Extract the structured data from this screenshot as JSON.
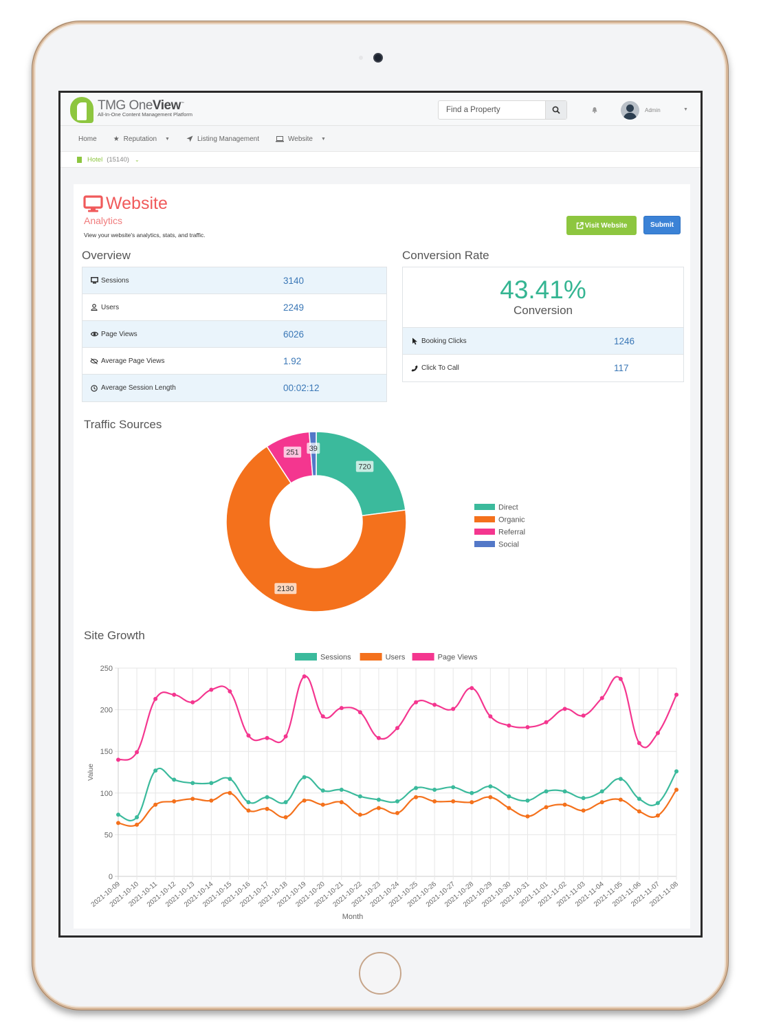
{
  "header": {
    "logo_main": "TMG One",
    "logo_bold": "View",
    "logo_tm": "™",
    "logo_sub": "All-In-One Content Management Platform",
    "search_placeholder": "Find a Property",
    "user_name": "Admin"
  },
  "nav": {
    "items": [
      {
        "label": "Home",
        "icon": "none",
        "has_caret": false
      },
      {
        "label": "Reputation",
        "icon": "star-icon",
        "has_caret": true
      },
      {
        "label": "Listing Management",
        "icon": "location-arrow-icon",
        "has_caret": false
      },
      {
        "label": "Website",
        "icon": "laptop-icon",
        "has_caret": true
      }
    ]
  },
  "property": {
    "type": "Hotel",
    "id": "(15140)"
  },
  "page": {
    "title": "Website",
    "subtitle": "Analytics",
    "description": "View your website's analytics, stats, and traffic.",
    "visit_button": "Visit Website",
    "submit_button": "Submit"
  },
  "overview": {
    "heading": "Overview",
    "rows": [
      {
        "label": "Sessions",
        "value": "3140",
        "icon": "desktop-icon"
      },
      {
        "label": "Users",
        "value": "2249",
        "icon": "user-icon"
      },
      {
        "label": "Page Views",
        "value": "6026",
        "icon": "eye-icon"
      },
      {
        "label": "Average Page Views",
        "value": "1.92",
        "icon": "eye-slash-icon"
      },
      {
        "label": "Average Session Length",
        "value": "00:02:12",
        "icon": "clock-icon"
      }
    ]
  },
  "conversion": {
    "heading": "Conversion Rate",
    "rate": "43.41%",
    "label": "Conversion",
    "rows": [
      {
        "label": "Booking Clicks",
        "value": "1246",
        "icon": "cursor-icon"
      },
      {
        "label": "Click To Call",
        "value": "117",
        "icon": "phone-icon"
      }
    ]
  },
  "colors": {
    "direct": "#3bba9c",
    "organic": "#f4711c",
    "referral": "#f4368f",
    "social": "#5378c8",
    "accent_red": "#f05a5b",
    "brand_green": "#8dc63f",
    "link_blue": "#3a77b6"
  },
  "chart_data": [
    {
      "type": "pie",
      "title": "Traffic Sources",
      "donut": true,
      "categories": [
        "Direct",
        "Organic",
        "Referral",
        "Social"
      ],
      "values": [
        720,
        2130,
        251,
        39
      ],
      "legend": "right"
    },
    {
      "type": "line",
      "title": "Site Growth",
      "xlabel": "Month",
      "ylabel": "Value",
      "ylim": [
        0,
        250
      ],
      "yticks": [
        0,
        50,
        100,
        150,
        200,
        250
      ],
      "grid": true,
      "legend": "top",
      "x": [
        "2021-10-09",
        "2021-10-10",
        "2021-10-11",
        "2021-10-12",
        "2021-10-13",
        "2021-10-14",
        "2021-10-15",
        "2021-10-16",
        "2021-10-17",
        "2021-10-18",
        "2021-10-19",
        "2021-10-20",
        "2021-10-21",
        "2021-10-22",
        "2021-10-23",
        "2021-10-24",
        "2021-10-25",
        "2021-10-26",
        "2021-10-27",
        "2021-10-28",
        "2021-10-29",
        "2021-10-30",
        "2021-10-31",
        "2021-11-01",
        "2021-11-02",
        "2021-11-03",
        "2021-11-04",
        "2021-11-05",
        "2021-11-06",
        "2021-11-07",
        "2021-11-08"
      ],
      "series": [
        {
          "name": "Sessions",
          "color": "#3bba9c",
          "values": [
            74,
            71,
            127,
            116,
            112,
            112,
            117,
            89,
            95,
            89,
            119,
            103,
            104,
            96,
            92,
            90,
            106,
            104,
            107,
            100,
            108,
            96,
            91,
            102,
            102,
            94,
            102,
            117,
            93,
            88,
            126
          ]
        },
        {
          "name": "Users",
          "color": "#f4711c",
          "values": [
            64,
            62,
            86,
            90,
            93,
            91,
            100,
            79,
            81,
            71,
            91,
            86,
            89,
            74,
            82,
            76,
            95,
            90,
            90,
            89,
            95,
            82,
            72,
            83,
            86,
            79,
            89,
            92,
            78,
            73,
            104
          ]
        },
        {
          "name": "Page Views",
          "color": "#f4368f",
          "values": [
            140,
            149,
            213,
            218,
            209,
            224,
            222,
            169,
            166,
            168,
            240,
            192,
            202,
            197,
            166,
            178,
            209,
            206,
            201,
            226,
            192,
            181,
            179,
            185,
            201,
            193,
            214,
            237,
            160,
            172,
            218
          ]
        }
      ]
    }
  ]
}
